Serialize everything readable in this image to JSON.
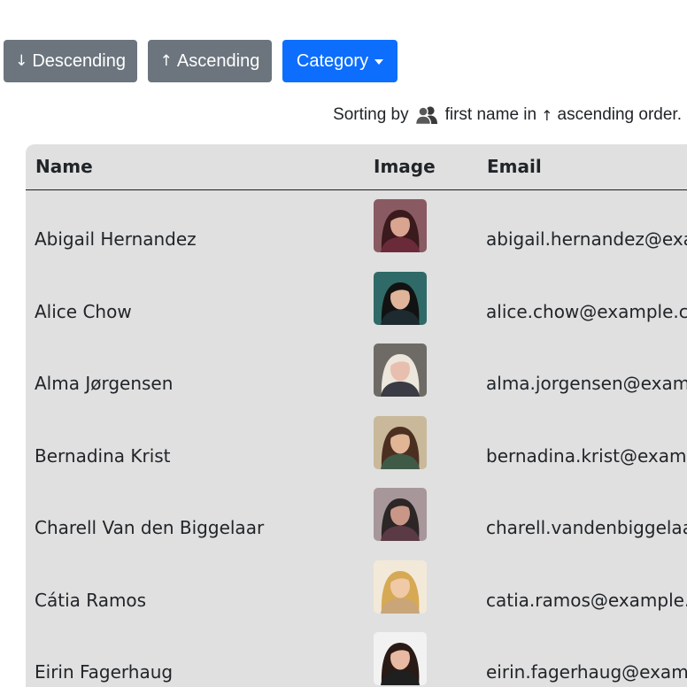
{
  "toolbar": {
    "descending": {
      "arrow": "↓",
      "label": "Descending"
    },
    "ascending": {
      "arrow": "↑",
      "label": "Ascending"
    },
    "category": {
      "label": "Category",
      "icon": "caret-down-icon"
    }
  },
  "sort_status": {
    "prefix": "Sorting by",
    "icon": "users-icon",
    "field": "first name in",
    "arrow": "↑",
    "suffix": "ascending order."
  },
  "table": {
    "headers": {
      "name": "Name",
      "image": "Image",
      "email": "Email"
    },
    "rows": [
      {
        "name": "Abigail Hernandez",
        "email": "abigail.hernandez@exa",
        "avatar": {
          "bg": "#8a5a62",
          "hair": "#3a1a1c",
          "skin": "#d9a590",
          "shirt": "#6b2a3a"
        }
      },
      {
        "name": "Alice Chow",
        "email": "alice.chow@example.c",
        "avatar": {
          "bg": "#2f6a68",
          "hair": "#121212",
          "skin": "#e0b49a",
          "shirt": "#1d2a30"
        }
      },
      {
        "name": "Alma Jørgensen",
        "email": "alma.jorgensen@exam",
        "avatar": {
          "bg": "#6e6a66",
          "hair": "#ece6dc",
          "skin": "#e8bfae",
          "shirt": "#3b3b45"
        }
      },
      {
        "name": "Bernadina Krist",
        "email": "bernadina.krist@exam",
        "avatar": {
          "bg": "#c9b99a",
          "hair": "#4b3021",
          "skin": "#e2b597",
          "shirt": "#405a48"
        }
      },
      {
        "name": "Charell Van den Biggelaar",
        "email": "charell.vandenbiggelaa",
        "avatar": {
          "bg": "#a7979a",
          "hair": "#2c2626",
          "skin": "#c99787",
          "shirt": "#5a3a44"
        }
      },
      {
        "name": "Cátia Ramos",
        "email": "catia.ramos@example.",
        "avatar": {
          "bg": "#f3e9d8",
          "hair": "#d6a955",
          "skin": "#f0c9a7",
          "shirt": "#caa57a"
        }
      },
      {
        "name": "Eirin Fagerhaug",
        "email": "eirin.fagerhaug@exam",
        "avatar": {
          "bg": "#f2f2f2",
          "hair": "#2a1a16",
          "skin": "#e8b9a3",
          "shirt": "#1f1f1f"
        }
      }
    ]
  }
}
